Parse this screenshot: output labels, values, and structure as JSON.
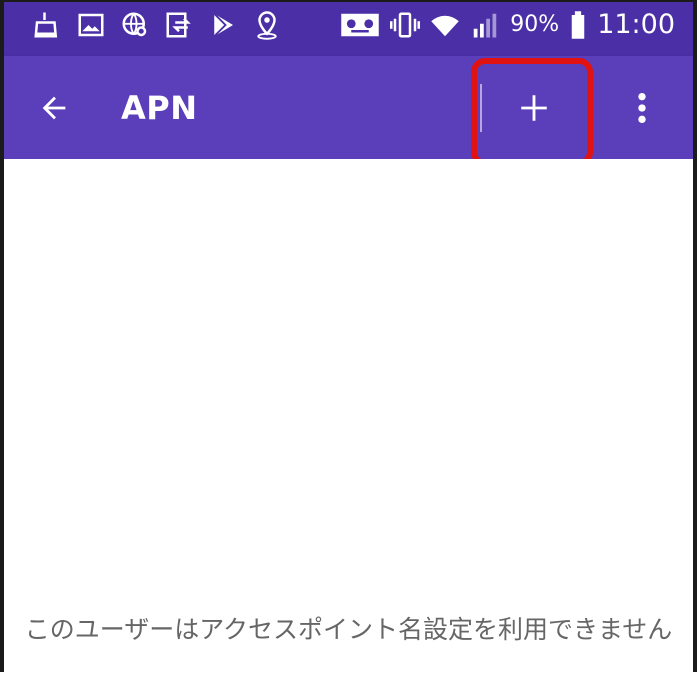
{
  "status_bar": {
    "battery": "90%",
    "time": "11:00",
    "left_icons": [
      "cleaner-icon",
      "gallery-icon",
      "web-icon",
      "sync-icon",
      "play-store-icon",
      "location-icon"
    ],
    "right_icons": [
      "voicemail-icon",
      "vibrate-icon",
      "wifi-icon",
      "signal-icon",
      "battery-icon"
    ]
  },
  "app_bar": {
    "title": "APN",
    "back_icon": "arrow-left-icon",
    "add_icon": "plus-icon",
    "more_icon": "more-vertical-icon"
  },
  "main": {
    "empty_message": "このユーザーはアクセスポイント名設定を利用できません"
  },
  "colors": {
    "status_bar_bg": "#4a2fa6",
    "app_bar_bg": "#5b3fba",
    "highlight": "#e01212",
    "message_text": "#666666"
  }
}
